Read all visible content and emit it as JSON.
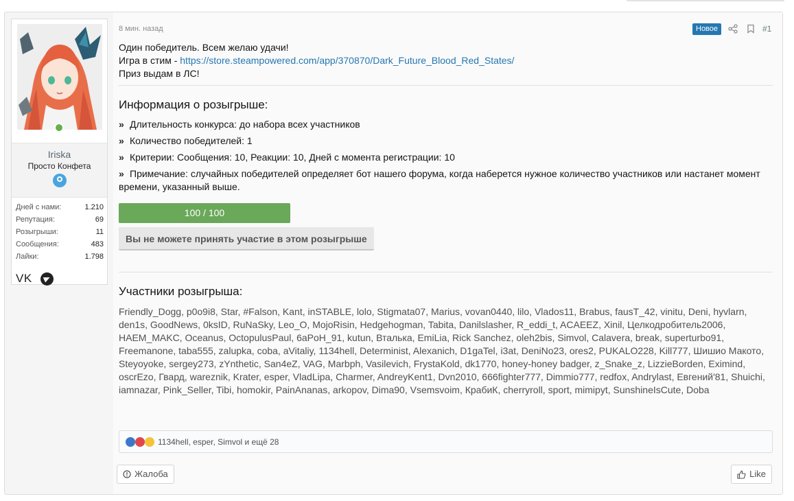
{
  "author": {
    "name": "Iriska",
    "title": "Просто Конфета",
    "stats": [
      {
        "label": "Дней с нами:",
        "value": "1.210"
      },
      {
        "label": "Репутация:",
        "value": "69"
      },
      {
        "label": "Розыгрыши:",
        "value": "11"
      },
      {
        "label": "Сообщения:",
        "value": "483"
      },
      {
        "label": "Лайки:",
        "value": "1.798"
      }
    ],
    "social_vk": "VK",
    "status_icon": "online-dot",
    "badge_icon": "user-badge-icon",
    "telegram_icon": "telegram-icon"
  },
  "post": {
    "time": "8 мин. назад",
    "new_badge": "Новое",
    "number": "#1",
    "line1": "Один победитель. Всем желаю удачи!",
    "line2_prefix": "Игра в стим - ",
    "line2_link": "https://store.steampowered.com/app/370870/Dark_Future_Blood_Red_States/",
    "line3": "Приз выдам в ЛС!"
  },
  "giveaway": {
    "info_title": "Информация о розыгрыше:",
    "bullet": "»",
    "duration": "Длительность конкурса: до набора всех участников",
    "winners": "Количество победителей: 1",
    "criteria": "Критерии: Сообщения: 10, Реакции: 10, Дней с момента регистрации: 10",
    "note": "Примечание: случайных победителей определяет бот нашего форума, когда наберется нужное количество участников или настанет момент времени, указанный выше.",
    "progress_text": "100 / 100",
    "progress_fraction": 1.0,
    "cannot_join": "Вы не можете принять участие в этом розыгрыше",
    "participants_title": "Участники розыгрыша:",
    "participants": "Friendly_Dogg, p0o9i8, Star, #Falson, Kant, inSTABLE, lolo, Stigmata07, Marius, vovan0440, lilo, Vlados11, Brabus, fausT_42, vinitu, Deni, hyvlarn, den1s, GoodNews, 0ksID, RuNaSky, Leo_O, MojoRisin, Hedgehogman, Tabita, Danilslasher, R_eddi_t, ACAEEZ, Xinil, Целкодробитель2006, HAEM_MAKC, Oceanus, OctopulusPaul, 6aPoH_91, kutun, Вталька, EmiLia, Rick Sanchez, oleh2bis, Simvol, Calavera, break, superturbo91, Freemanone, taba555, zalupka, coba, aVitaliy, 1134hell, Determinist, Alexanich, D1gaTel, i3at, DeniNo23, ores2, PUKALO228, Kill777, Шишио Макото, Steyoyoke, sergey273, zYnthetic, San4eZ, VAG, Marbph, Vasilevich, FrystaKold, dk1770, honey-honey badger, z_Snake_z, LizzieBorden, Eximind, oscrEzo, Гвард, wareznik, Krater, esper, VladLipa, Charmer, AndreyKent1, Dvn2010, 666fighter777, Dimmio777, redfox, Andrylast, Евгений'81, Shuichi, iamnazar, Pink_Seller, Tibi, homokir, PainAnanas, arkopov, Dima90, Vsemsvoim, КрабиК, cherryroll, sport, mimipyt, SunshineIsCute, Doba"
  },
  "reactions": {
    "text": "1134hell, esper, Simvol и ещё 28",
    "icons": [
      "like-reaction-icon",
      "love-reaction-icon",
      "wow-reaction-icon"
    ]
  },
  "actions": {
    "complain": "Жалоба",
    "like": "Like"
  },
  "colors": {
    "accent": "#2577b1",
    "progress": "#6aa85a",
    "online": "#63b14a"
  }
}
